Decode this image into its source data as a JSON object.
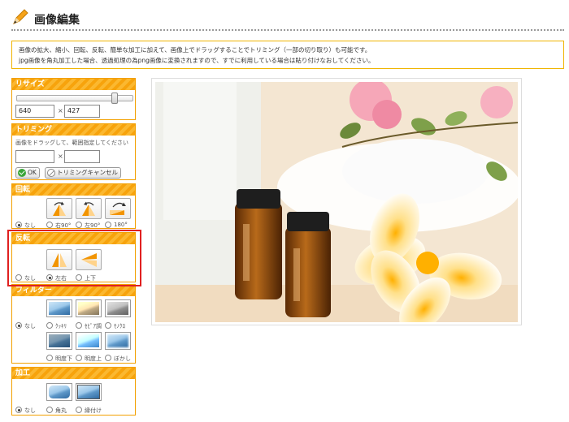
{
  "page": {
    "title": "画像編集"
  },
  "notice": {
    "line1": "画像の拡大、縮小、回転、反転、簡単な加工に加えて、画像上でドラッグすることでトリミング（一部の切り取り）も可能です。",
    "line2": "jpg画像を角丸加工した場合、透過処理の為png画像に変換されますので、すでに利用している場合は貼り付けなおしてください。"
  },
  "resize": {
    "header": "リサイズ",
    "width": "640",
    "height": "427",
    "times": "×",
    "slider_fraction": 0.86
  },
  "trim": {
    "header": "トリミング",
    "hint": "画像をドラッグして、範囲指定してください",
    "times": "×",
    "ok_label": "OK",
    "cancel_label": "トリミングキャンセル"
  },
  "rotate": {
    "header": "回転",
    "options": [
      "なし",
      "右90°",
      "左90°",
      "180°"
    ]
  },
  "flip": {
    "header": "反転",
    "options": [
      "なし",
      "左右",
      "上下"
    ]
  },
  "filter": {
    "header": "フィルター",
    "options_row1": [
      "なし",
      "ｸｯｷﾘ",
      "ｾﾋﾟｱ調",
      "ﾓﾉｸﾛ"
    ],
    "options_row2": [
      "明度下",
      "明度上",
      "ぼかし"
    ]
  },
  "process": {
    "header": "加工",
    "options": [
      "なし",
      "角丸",
      "縁付け"
    ]
  },
  "colors": {
    "accent": "#f7a30c",
    "highlight": "#e02020"
  }
}
